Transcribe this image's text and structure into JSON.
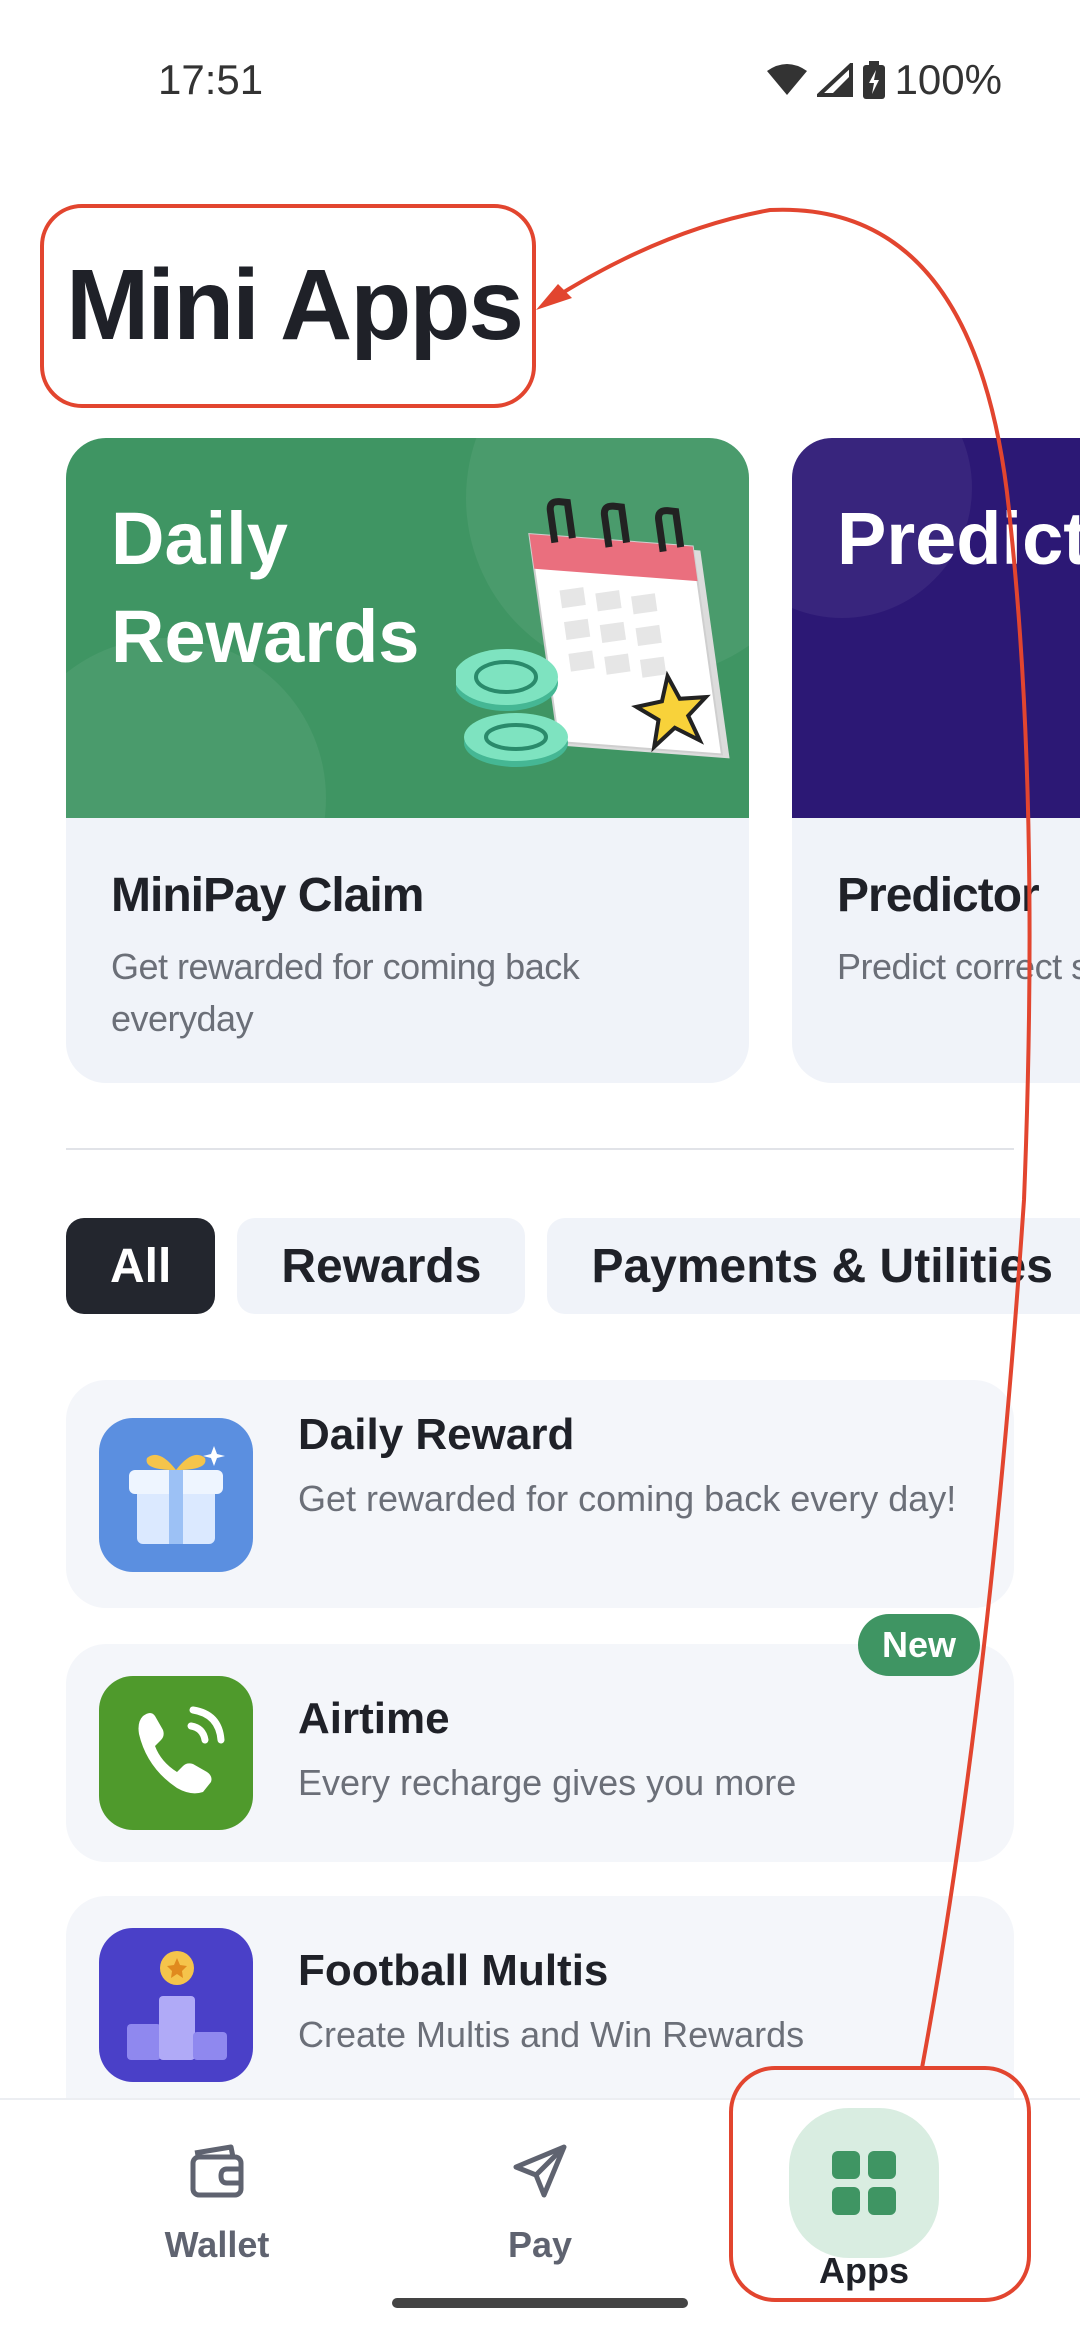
{
  "status_bar": {
    "time": "17:51",
    "battery": "100%",
    "icons": [
      "wifi-icon",
      "signal-icon",
      "battery-charging-icon"
    ]
  },
  "page": {
    "title": "Mini Apps"
  },
  "featured": [
    {
      "banner_title": "Daily Rewards",
      "name": "MiniPay Claim",
      "description": "Get rewarded for coming back everyday",
      "color": "#3f9563"
    },
    {
      "banner_title": "Predict Win",
      "name": "Predictor",
      "description": "Predict correct s",
      "color": "#2c1875"
    }
  ],
  "filters": {
    "active": "All",
    "items": [
      "All",
      "Rewards",
      "Payments & Utilities"
    ]
  },
  "apps": [
    {
      "title": "Daily Reward",
      "description": "Get rewarded for coming back every day!",
      "icon": "gift-icon",
      "color": "#5b8fe0"
    },
    {
      "title": "Airtime",
      "description": "Every recharge gives you more",
      "icon": "phone-call-icon",
      "color": "#4f9a2c",
      "badge": "New"
    },
    {
      "title": "Football Multis",
      "description": "Create Multis and Win Rewards",
      "icon": "podium-icon",
      "color": "#4a40c8"
    }
  ],
  "bottom_nav": {
    "active": "Apps",
    "items": [
      {
        "label": "Wallet",
        "icon": "wallet-icon"
      },
      {
        "label": "Pay",
        "icon": "send-icon"
      },
      {
        "label": "Apps",
        "icon": "apps-grid-icon"
      }
    ]
  },
  "colors": {
    "accent": "#3f9563",
    "annotation": "#e2452f",
    "text": "#1f2128"
  }
}
